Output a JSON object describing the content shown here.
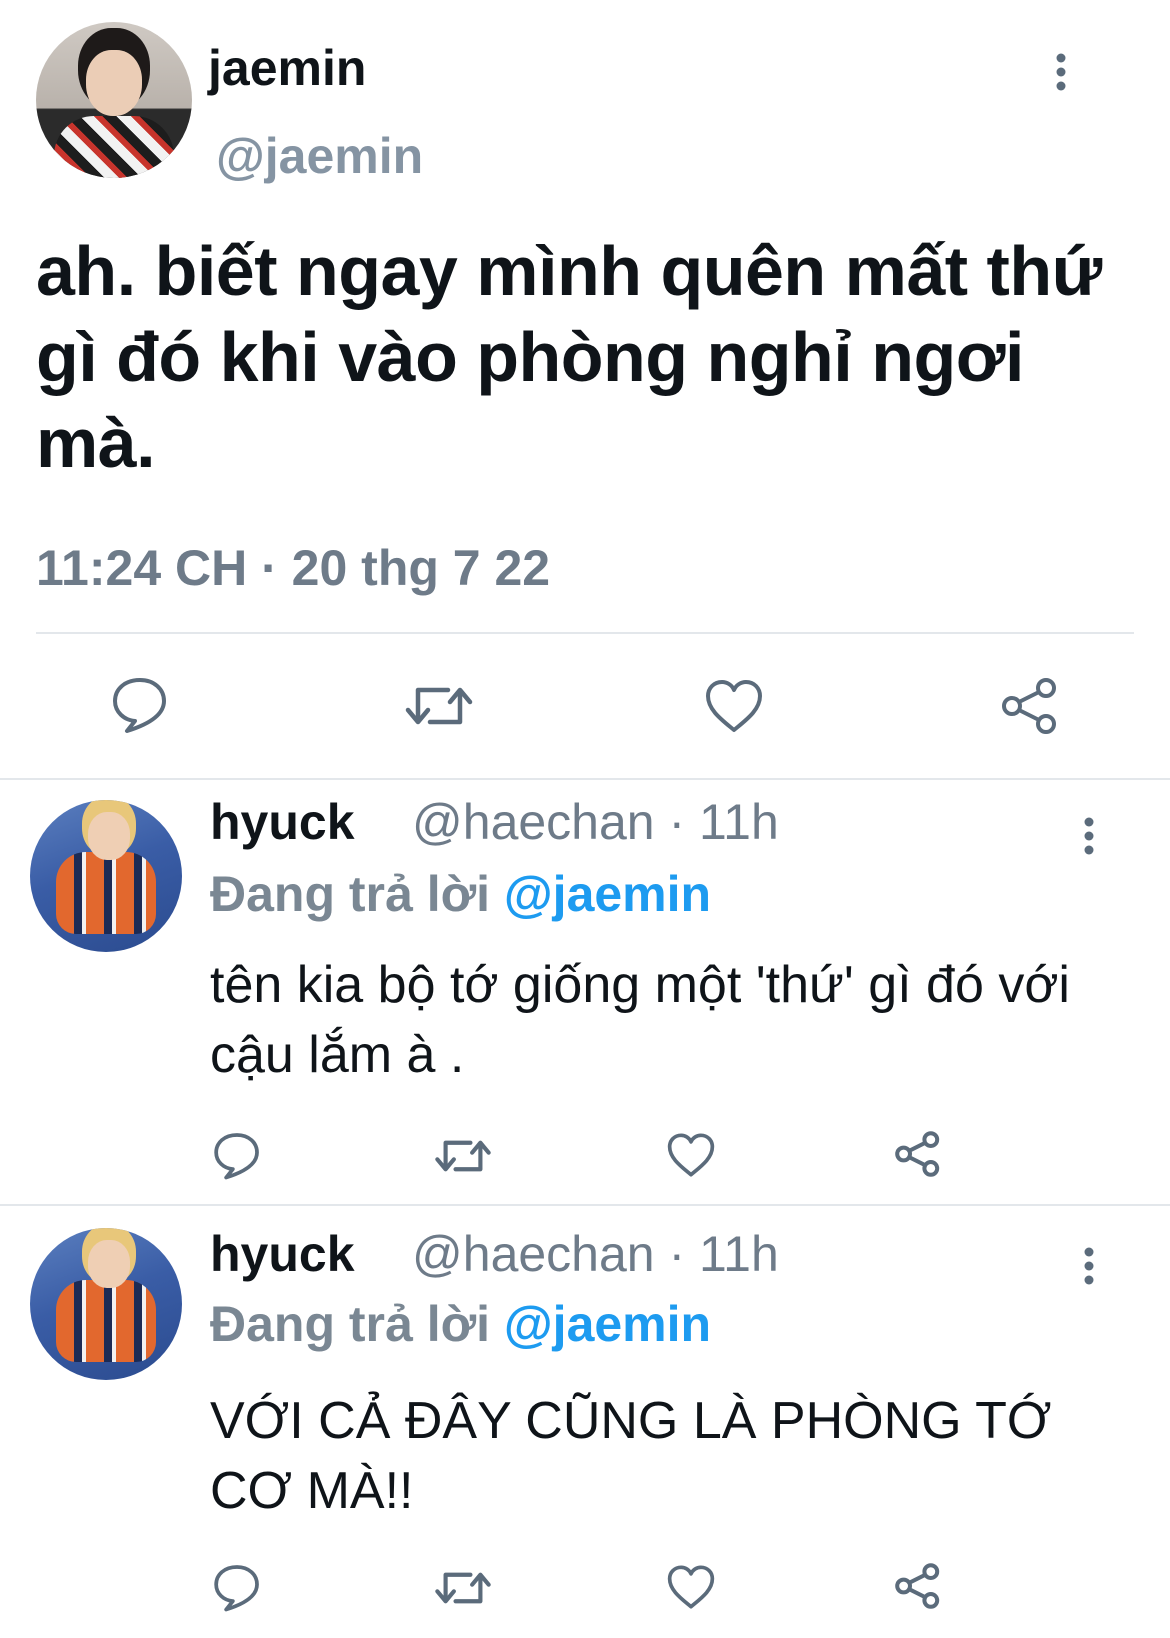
{
  "main_tweet": {
    "display_name": "jaemin",
    "handle": "@jaemin",
    "text": "ah. biết ngay mình quên mất thứ gì đó khi vào phòng nghỉ ngơi mà.",
    "timestamp": "11:24 CH · 20 thg 7 22",
    "icons": [
      "comment-icon",
      "retweet-icon",
      "like-icon",
      "share-icon"
    ]
  },
  "replies": [
    {
      "display_name": "hyuck",
      "handle_meta": "@haechan · 11h",
      "replying_prefix": "Đang trả lời ",
      "replying_to": "@jaemin",
      "text": "tên kia bộ tớ giống một 'thứ' gì đó với cậu lắm à ."
    },
    {
      "display_name": "hyuck",
      "handle_meta": "@haechan · 11h",
      "replying_prefix": "Đang trả lời ",
      "replying_to": "@jaemin",
      "text": "VỚI CẢ ĐÂY CŨNG LÀ PHÒNG TỚ CƠ MÀ!!"
    }
  ],
  "colors": {
    "text": "#0f1419",
    "secondary": "#6e7b89",
    "mention": "#1d9bf0",
    "divider": "#e3e7eb",
    "icon": "#5b6b7b"
  }
}
